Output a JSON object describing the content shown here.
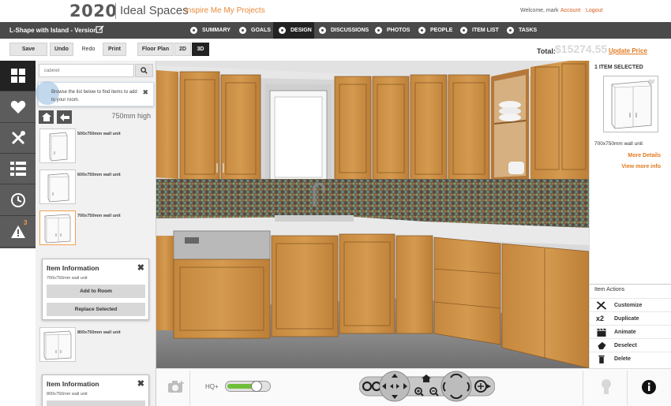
{
  "header": {
    "logo_text": "2020",
    "brand": "Ideal Spaces",
    "tagline": "Inspire Me  My Projects",
    "welcome": "Welcome, mark",
    "account": "Account",
    "logout": "Logout"
  },
  "nav": {
    "project_title": "L-Shape with Island - Version",
    "tabs": [
      {
        "label": "SUMMARY",
        "icon": "globe-icon"
      },
      {
        "label": "GOALS",
        "icon": "check-circle-icon"
      },
      {
        "label": "DESIGN",
        "icon": "pencil-circle-icon"
      },
      {
        "label": "DISCUSSIONS",
        "icon": "chat-icon"
      },
      {
        "label": "PHOTOS",
        "icon": "camera-circle-icon"
      },
      {
        "label": "PEOPLE",
        "icon": "person-icon"
      },
      {
        "label": "ITEM LIST",
        "icon": "list-icon"
      },
      {
        "label": "TASKS",
        "icon": "check-icon"
      }
    ]
  },
  "toolbar": {
    "save": "Save",
    "undo": "Undo",
    "redo": "Redo",
    "print": "Print",
    "floor_plan": "Floor Plan",
    "view_2d": "2D",
    "view_3d": "3D",
    "total_label": "Total:",
    "total_value": "$15274.55",
    "update_price": "Update Price"
  },
  "catalog": {
    "search_placeholder": "cabinet",
    "tooltip": "Browse the list below to find items to add to your room.",
    "height_label": "750mm high",
    "items": [
      {
        "label": "500x750mm wall unit"
      },
      {
        "label": "600x750mm wall unit"
      },
      {
        "label": "700x750mm wall unit"
      },
      {
        "label": "800x750mm wall unit"
      }
    ],
    "info_cards": [
      {
        "title": "Item Information",
        "subtitle": "700x750mm wall unit",
        "add_label": "Add to Room",
        "replace_label": "Replace Selected"
      },
      {
        "title": "Item Information",
        "subtitle": "800x750mm wall unit"
      }
    ],
    "warning_count": "3"
  },
  "selection": {
    "count_label": "1 ITEM SELECTED",
    "item_name": "700x750mm wall unit",
    "more_details": "More Details",
    "view_more": "View more info"
  },
  "actions": {
    "title": "Item Actions",
    "items": [
      {
        "label": "Customize",
        "icon": "tools-icon"
      },
      {
        "label": "Duplicate",
        "icon": "x2-icon",
        "glyph": "x2"
      },
      {
        "label": "Animate",
        "icon": "clapper-icon"
      },
      {
        "label": "Deselect",
        "icon": "pointer-icon"
      },
      {
        "label": "Delete",
        "icon": "trash-icon"
      }
    ]
  },
  "viewer": {
    "hq_label": "HQ+",
    "hq_level": 0.72
  },
  "colors": {
    "accent": "#e07a20",
    "nav_bg": "#4a4a4a",
    "cabinet": "#c98e45",
    "hq_green": "#6fbe3a"
  }
}
